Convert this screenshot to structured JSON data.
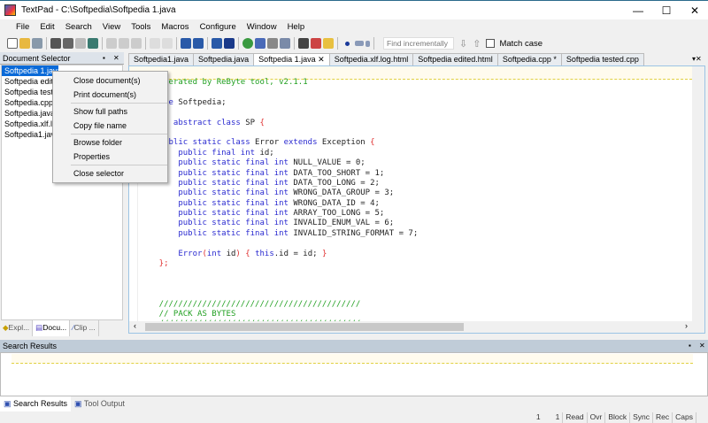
{
  "window": {
    "title": "TextPad - C:\\Softpedia\\Softpedia 1.java",
    "minimize": "—",
    "maximize": "☐",
    "close": "✕"
  },
  "menu": [
    "File",
    "Edit",
    "Search",
    "View",
    "Tools",
    "Macros",
    "Configure",
    "Window",
    "Help"
  ],
  "toolbar": {
    "find_placeholder": "Find incrementally",
    "find_down": "⇩",
    "find_up": "⇧",
    "match_case": "Match case"
  },
  "doc_selector": {
    "title": "Document Selector",
    "pin": "▪",
    "close": "✕",
    "items": [
      "Softpedia 1.java",
      "Softpedia edited.html",
      "Softpedia tested.cpp",
      "Softpedia.cpp",
      "Softpedia.java",
      "Softpedia.xlf.log.html",
      "Softpedia1.java"
    ],
    "selected": 0
  },
  "left_tabs": [
    "Expl...",
    "Docu...",
    "Clip ..."
  ],
  "editor_tabs": [
    "Softpedia1.java",
    "Softpedia.java",
    "Softpedia 1.java",
    "Softpedia.xlf.log.html",
    "Softpedia edited.html",
    "Softpedia.cpp *",
    "Softpedia tested.cpp"
  ],
  "active_tab": 2,
  "tab_close": "✕",
  "code": [
    [
      [
        "cm",
        "// Generated by ReByte tool, v2.1.1"
      ]
    ],
    [],
    [
      [
        "kw",
        "package "
      ],
      [
        "id",
        "Softpedia;"
      ]
    ],
    [],
    [
      [
        "kw",
        "public abstract class "
      ],
      [
        "id",
        "SP "
      ],
      [
        "br",
        "{"
      ]
    ],
    [],
    [
      [
        "kw",
        "    public static class "
      ],
      [
        "id",
        "Error "
      ],
      [
        "kw",
        "extends "
      ],
      [
        "id",
        "Exception "
      ],
      [
        "br",
        "{"
      ]
    ],
    [
      [
        "kw",
        "        public final int "
      ],
      [
        "id",
        "id;"
      ]
    ],
    [
      [
        "kw",
        "        public static final int "
      ],
      [
        "id",
        "NULL_VALUE = 0;"
      ]
    ],
    [
      [
        "kw",
        "        public static final int "
      ],
      [
        "id",
        "DATA_TOO_SHORT = 1;"
      ]
    ],
    [
      [
        "kw",
        "        public static final int "
      ],
      [
        "id",
        "DATA_TOO_LONG = 2;"
      ]
    ],
    [
      [
        "kw",
        "        public static final int "
      ],
      [
        "id",
        "WRONG_DATA_GROUP = 3;"
      ]
    ],
    [
      [
        "kw",
        "        public static final int "
      ],
      [
        "id",
        "WRONG_DATA_ID = 4;"
      ]
    ],
    [
      [
        "kw",
        "        public static final int "
      ],
      [
        "id",
        "ARRAY_TOO_LONG = 5;"
      ]
    ],
    [
      [
        "kw",
        "        public static final int "
      ],
      [
        "id",
        "INVALID_ENUM_VAL = 6;"
      ]
    ],
    [
      [
        "kw",
        "        public static final int "
      ],
      [
        "id",
        "INVALID_STRING_FORMAT = 7;"
      ]
    ],
    [],
    [
      [
        "kw",
        "        Error"
      ],
      [
        "br",
        "("
      ],
      [
        "kw",
        "int "
      ],
      [
        "id",
        "id"
      ],
      [
        "br",
        ") {"
      ],
      [
        "kw",
        " this"
      ],
      [
        "id",
        ".id = id; "
      ],
      [
        "br",
        "}"
      ]
    ],
    [
      [
        "br",
        "    };"
      ]
    ],
    [],
    [],
    [],
    [
      [
        "cm",
        "    //////////////////////////////////////////"
      ]
    ],
    [
      [
        "cm",
        "    // PACK AS BYTES"
      ]
    ],
    [
      [
        "cm",
        "    //////////////////////////////////////////"
      ]
    ]
  ],
  "context_menu": [
    [
      "Close document(s)",
      "Print document(s)"
    ],
    [
      "Show full paths",
      "Copy file name"
    ],
    [
      "Browse folder",
      "Properties"
    ],
    [
      "Close selector"
    ]
  ],
  "search_results": {
    "title": "Search Results"
  },
  "bottom_tabs": [
    "Search Results",
    "Tool Output"
  ],
  "status": [
    "1",
    "1",
    "Read",
    "Ovr",
    "Block",
    "Sync",
    "Rec",
    "Caps"
  ],
  "colors": {
    "comment": "#22a022",
    "keyword": "#2a2ad0",
    "brace": "#e03030",
    "selection": "#0a6ad8"
  }
}
